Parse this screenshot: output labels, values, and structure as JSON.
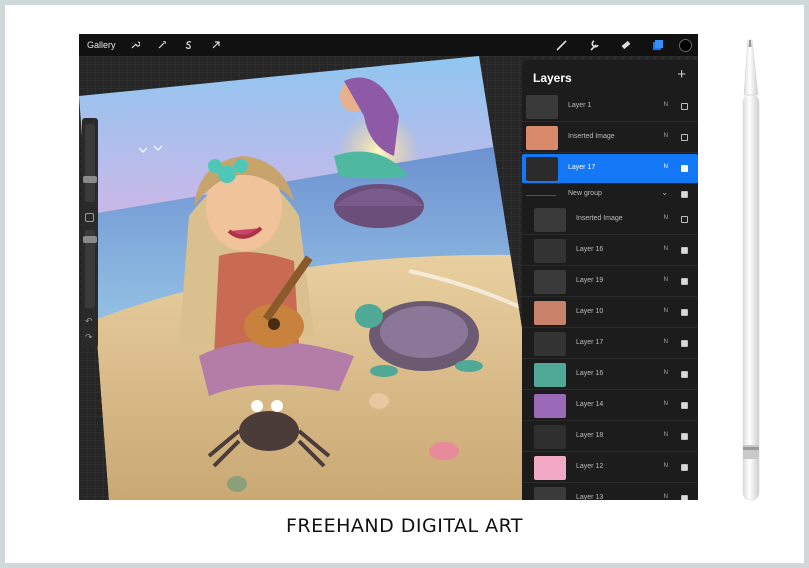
{
  "toolbar": {
    "gallery_label": "Gallery",
    "left_icons": [
      "wrench-icon",
      "magic-wand-icon",
      "selection-icon",
      "transform-arrow-icon"
    ],
    "right_icons": [
      "brush-icon",
      "smudge-icon",
      "eraser-icon",
      "layers-icon"
    ],
    "active_color": "#000000",
    "layers_accent": "#1477f5"
  },
  "layers_panel": {
    "title": "Layers",
    "add_label": "+",
    "rows": [
      {
        "kind": "layer",
        "name": "Layer 1",
        "mode": "N",
        "visible": false,
        "active": false
      },
      {
        "kind": "layer",
        "name": "Inserted Image",
        "mode": "N",
        "visible": false,
        "active": false
      },
      {
        "kind": "layer",
        "name": "Layer 17",
        "mode": "N",
        "visible": true,
        "active": true
      },
      {
        "kind": "group",
        "name": "New group",
        "mode": "",
        "visible": true,
        "active": false
      },
      {
        "kind": "layer",
        "name": "Inserted Image",
        "mode": "N",
        "visible": false,
        "active": false
      },
      {
        "kind": "layer",
        "name": "Layer 16",
        "mode": "N",
        "visible": true,
        "active": false
      },
      {
        "kind": "layer",
        "name": "Layer 19",
        "mode": "N",
        "visible": true,
        "active": false
      },
      {
        "kind": "layer",
        "name": "Layer 10",
        "mode": "N",
        "visible": true,
        "active": false
      },
      {
        "kind": "layer",
        "name": "Layer 17",
        "mode": "N",
        "visible": true,
        "active": false
      },
      {
        "kind": "layer",
        "name": "Layer 16",
        "mode": "N",
        "visible": true,
        "active": false
      },
      {
        "kind": "layer",
        "name": "Layer 14",
        "mode": "N",
        "visible": true,
        "active": false
      },
      {
        "kind": "layer",
        "name": "Layer 18",
        "mode": "N",
        "visible": true,
        "active": false
      },
      {
        "kind": "layer",
        "name": "Layer 12",
        "mode": "N",
        "visible": true,
        "active": false
      },
      {
        "kind": "layer",
        "name": "Layer 13",
        "mode": "N",
        "visible": true,
        "active": false
      }
    ]
  },
  "sidebar": {
    "undo_icon": "undo-icon",
    "redo_icon": "redo-icon"
  },
  "caption": "FREEHAND DIGITAL ART"
}
